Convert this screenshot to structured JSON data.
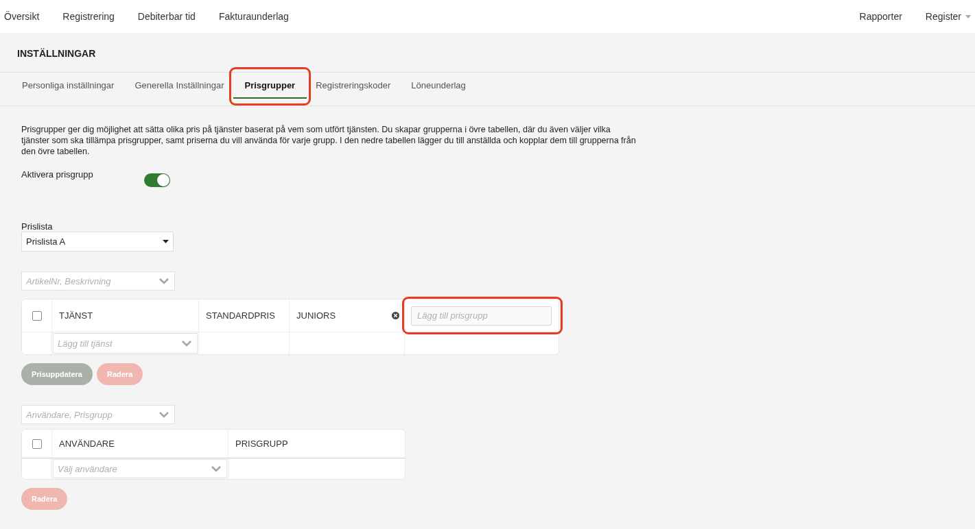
{
  "top_nav": {
    "left": [
      {
        "label": "Översikt"
      },
      {
        "label": "Registrering"
      },
      {
        "label": "Debiterbar tid"
      },
      {
        "label": "Fakturaunderlag"
      }
    ],
    "right": [
      {
        "label": "Rapporter",
        "has_menu": false
      },
      {
        "label": "Register",
        "has_menu": true
      }
    ]
  },
  "page_title": "INSTÄLLNINGAR",
  "tabs": [
    {
      "label": "Personliga inställningar",
      "selected": false,
      "highlighted": false
    },
    {
      "label": "Generella Inställningar",
      "selected": false,
      "highlighted": false
    },
    {
      "label": "Prisgrupper",
      "selected": true,
      "highlighted": true
    },
    {
      "label": "Registreringskoder",
      "selected": false,
      "highlighted": false
    },
    {
      "label": "Löneunderlag",
      "selected": false,
      "highlighted": false
    }
  ],
  "description": "Prisgrupper ger dig möjlighet att sätta olika pris på tjänster baserat på vem som utfört tjänsten. Du skapar grupperna i övre tabellen, där du även väljer vilka tjänster som ska tillämpa prisgrupper, samt priserna du vill använda för varje grupp. I den nedre tabellen lägger du till anställda och kopplar dem till grupperna från den övre tabellen.",
  "activate": {
    "label": "Aktivera prisgrupp",
    "on": true
  },
  "price_list": {
    "label": "Prislista",
    "value": "Prislista A"
  },
  "services": {
    "search": {
      "placeholder": "ArtikelNr, Beskrivning"
    },
    "all_checked": false,
    "columns": [
      {
        "label": "TJÄNST",
        "removable": false
      },
      {
        "label": "STANDARDPRIS",
        "removable": false
      },
      {
        "label": "JUNIORS",
        "removable": true
      }
    ],
    "add_service": {
      "placeholder": "Lägg till tjänst"
    },
    "add_group": {
      "placeholder": "Lägg till prisgrupp",
      "highlighted": true
    },
    "buttons": [
      {
        "label": "Prisuppdatera",
        "kind": "neutral",
        "disabled": true
      },
      {
        "label": "Radera",
        "kind": "danger",
        "disabled": true
      }
    ]
  },
  "users": {
    "search": {
      "placeholder": "Användare, Prisgrupp"
    },
    "all_checked": false,
    "columns": [
      {
        "label": "ANVÄNDARE"
      },
      {
        "label": "PRISGRUPP"
      }
    ],
    "add_user": {
      "placeholder": "Välj användare"
    },
    "buttons": [
      {
        "label": "Radera",
        "kind": "danger",
        "disabled": true
      }
    ]
  }
}
